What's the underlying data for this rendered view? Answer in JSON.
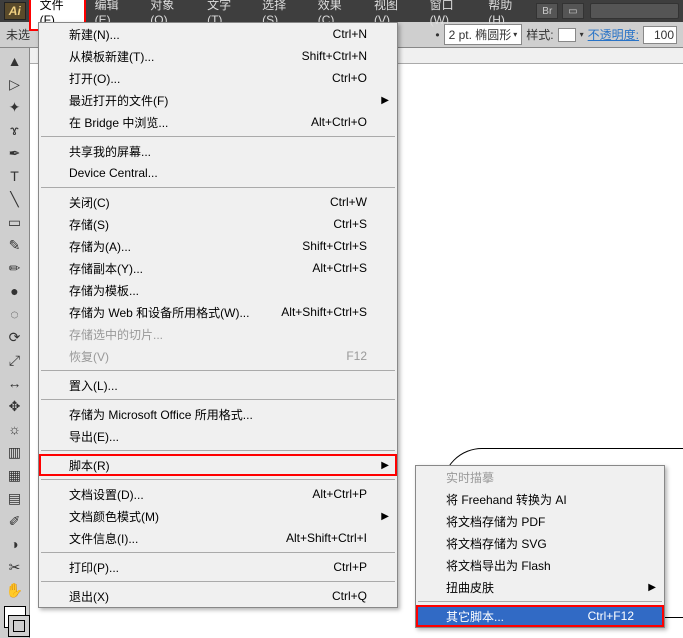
{
  "menubar": {
    "logo": "Ai",
    "items": [
      "文件(F)",
      "编辑(E)",
      "对象(O)",
      "文字(T)",
      "选择(S)",
      "效果(C)",
      "视图(V)",
      "窗口(W)",
      "帮助(H)"
    ],
    "active_index": 0
  },
  "optbar": {
    "doc_label": "未选",
    "stroke_value": "2 pt. 椭圆形",
    "style_label": "样式:",
    "opacity_label": "不透明度:",
    "opacity_value": "100"
  },
  "file_menu": [
    {
      "label": "新建(N)...",
      "shortcut": "Ctrl+N"
    },
    {
      "label": "从模板新建(T)...",
      "shortcut": "Shift+Ctrl+N"
    },
    {
      "label": "打开(O)...",
      "shortcut": "Ctrl+O"
    },
    {
      "label": "最近打开的文件(F)",
      "submenu": true
    },
    {
      "label": "在 Bridge 中浏览...",
      "shortcut": "Alt+Ctrl+O"
    },
    {
      "sep": true
    },
    {
      "label": "共享我的屏幕..."
    },
    {
      "label": "Device Central..."
    },
    {
      "sep": true
    },
    {
      "label": "关闭(C)",
      "shortcut": "Ctrl+W"
    },
    {
      "label": "存储(S)",
      "shortcut": "Ctrl+S"
    },
    {
      "label": "存储为(A)...",
      "shortcut": "Shift+Ctrl+S"
    },
    {
      "label": "存储副本(Y)...",
      "shortcut": "Alt+Ctrl+S"
    },
    {
      "label": "存储为模板..."
    },
    {
      "label": "存储为 Web 和设备所用格式(W)...",
      "shortcut": "Alt+Shift+Ctrl+S"
    },
    {
      "label": "存储选中的切片...",
      "disabled": true
    },
    {
      "label": "恢复(V)",
      "shortcut": "F12",
      "disabled": true
    },
    {
      "sep": true
    },
    {
      "label": "置入(L)..."
    },
    {
      "sep": true
    },
    {
      "label": "存储为 Microsoft Office 所用格式..."
    },
    {
      "label": "导出(E)..."
    },
    {
      "sep": true
    },
    {
      "label": "脚本(R)",
      "submenu": true,
      "highlight": true
    },
    {
      "sep": true
    },
    {
      "label": "文档设置(D)...",
      "shortcut": "Alt+Ctrl+P"
    },
    {
      "label": "文档颜色模式(M)",
      "submenu": true
    },
    {
      "label": "文件信息(I)...",
      "shortcut": "Alt+Shift+Ctrl+I"
    },
    {
      "sep": true
    },
    {
      "label": "打印(P)...",
      "shortcut": "Ctrl+P"
    },
    {
      "sep": true
    },
    {
      "label": "退出(X)",
      "shortcut": "Ctrl+Q"
    }
  ],
  "script_submenu": [
    {
      "label": "实时描摹",
      "disabled": true
    },
    {
      "label": "将 Freehand 转换为 AI"
    },
    {
      "label": "将文档存储为 PDF"
    },
    {
      "label": "将文档存储为 SVG"
    },
    {
      "label": "将文档导出为 Flash"
    },
    {
      "label": "扭曲皮肤",
      "submenu": true
    },
    {
      "sep": true
    },
    {
      "label": "其它脚本...",
      "shortcut": "Ctrl+F12",
      "highlight2": true
    }
  ],
  "tools": [
    "sel",
    "dsel",
    "wand",
    "lasso",
    "pen",
    "type",
    "line",
    "rect",
    "brush",
    "pencil",
    "blob",
    "erase",
    "rot",
    "scale",
    "warp",
    "sym",
    "graph",
    "mesh",
    "grad",
    "eye",
    "blend",
    "slice",
    "art",
    "hand",
    "zoom"
  ]
}
